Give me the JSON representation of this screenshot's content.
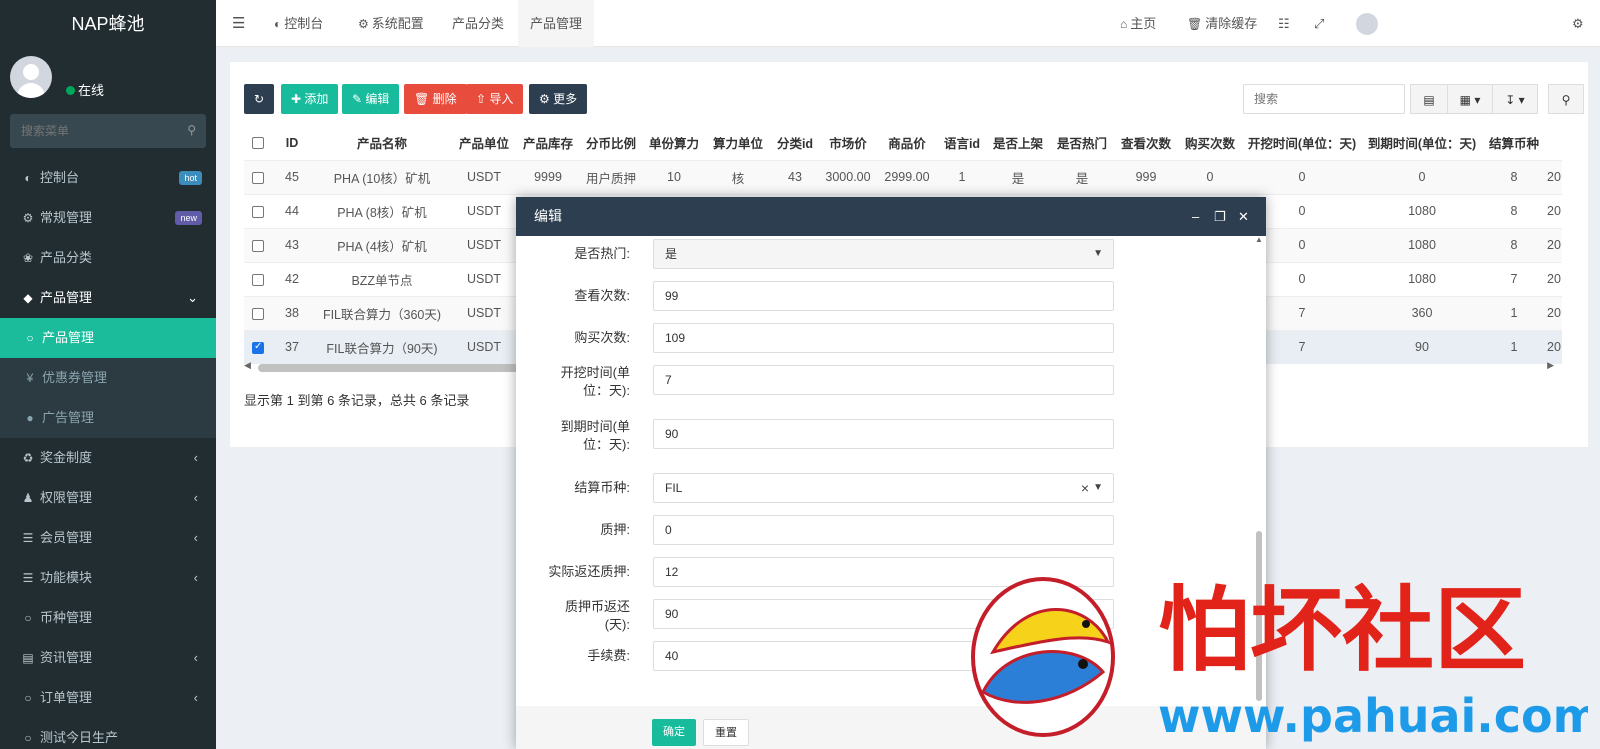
{
  "app": {
    "title": "NAP蜂池",
    "status": "在线",
    "search_placeholder": "搜索菜单"
  },
  "sidebar": {
    "items": [
      {
        "label": "控制台",
        "icon": "dashboard-icon",
        "badge": "hot",
        "badge_color": "#3c8dbc"
      },
      {
        "label": "常规管理",
        "icon": "cogs-icon",
        "badge": "new",
        "badge_color": "#605ca8"
      },
      {
        "label": "产品分类",
        "icon": "leaf-icon"
      },
      {
        "label": "产品管理",
        "icon": "diamond-icon",
        "expanded": true
      },
      {
        "label": "产品管理",
        "icon": "circle-icon",
        "active": true
      },
      {
        "label": "优惠券管理",
        "icon": "yen-icon"
      },
      {
        "label": "广告管理",
        "icon": "dot-icon"
      },
      {
        "label": "奖金制度",
        "icon": "recycle-icon"
      },
      {
        "label": "权限管理",
        "icon": "group-icon"
      },
      {
        "label": "会员管理",
        "icon": "list-icon"
      },
      {
        "label": "功能模块",
        "icon": "list-icon"
      },
      {
        "label": "币种管理",
        "icon": "circle-icon"
      },
      {
        "label": "资讯管理",
        "icon": "table-icon"
      },
      {
        "label": "订单管理",
        "icon": "circle-icon"
      },
      {
        "label": "测试今日生产",
        "icon": "circle-icon"
      }
    ]
  },
  "topbar": {
    "tabs": [
      "控制台",
      "系统配置",
      "产品分类",
      "产品管理"
    ],
    "home": "主页",
    "clear_cache": "清除缓存"
  },
  "toolbar": {
    "add": "添加",
    "edit": "编辑",
    "delete": "删除",
    "import": "导入",
    "more": "更多",
    "search_placeholder": "搜索",
    "colors": {
      "dark": "#2c3e50",
      "green": "#18bc9c",
      "red": "#e74c3c",
      "orange": "#f39c12"
    }
  },
  "table": {
    "columns": [
      "ID",
      "产品名称",
      "产品单位",
      "产品库存",
      "分币比例",
      "单份算力",
      "算力单位",
      "分类id",
      "市场价",
      "商品价",
      "语言id",
      "是否上架",
      "是否热门",
      "查看次数",
      "购买次数",
      "开挖时间(单位：天)",
      "到期时间(单位：天)",
      "结算币种"
    ],
    "rows": [
      {
        "checked": false,
        "cells": [
          "45",
          "PHA (10核）矿机",
          "USDT",
          "9999",
          "用户质押",
          "10",
          "核",
          "43",
          "3000.00",
          "2999.00",
          "1",
          "是",
          "是",
          "999",
          "0",
          "0",
          "0",
          "8"
        ],
        "tail": "20"
      },
      {
        "checked": false,
        "cells": [
          "44",
          "PHA (8核）矿机",
          "USDT",
          "",
          "",
          "",
          "",
          "",
          "",
          "",
          "",
          "",
          "",
          "",
          "",
          "0",
          "1080",
          "8"
        ],
        "tail": "20"
      },
      {
        "checked": false,
        "cells": [
          "43",
          "PHA (4核）矿机",
          "USDT",
          "",
          "",
          "",
          "",
          "",
          "",
          "",
          "",
          "",
          "",
          "",
          "",
          "0",
          "1080",
          "8"
        ],
        "tail": "20"
      },
      {
        "checked": false,
        "cells": [
          "42",
          "BZZ单节点",
          "USDT",
          "",
          "",
          "",
          "",
          "",
          "",
          "",
          "",
          "",
          "",
          "",
          "",
          "0",
          "1080",
          "7"
        ],
        "tail": "20"
      },
      {
        "checked": false,
        "cells": [
          "38",
          "FIL联合算力（360天)",
          "USDT",
          "",
          "",
          "",
          "",
          "",
          "",
          "",
          "",
          "",
          "",
          "",
          "",
          "7",
          "360",
          "1"
        ],
        "tail": "20"
      },
      {
        "checked": true,
        "cells": [
          "37",
          "FIL联合算力（90天)",
          "USDT",
          "",
          "",
          "",
          "",
          "",
          "",
          "",
          "",
          "",
          "",
          "",
          "",
          "7",
          "90",
          "1"
        ],
        "tail": "20"
      }
    ],
    "pager": "显示第 1 到第 6 条记录，总共 6 条记录"
  },
  "modal": {
    "title": "编辑",
    "fields": [
      {
        "label": "是否热门:",
        "value": "是",
        "type": "select"
      },
      {
        "label": "查看次数:",
        "value": "99"
      },
      {
        "label": "购买次数:",
        "value": "109"
      },
      {
        "label": "开挖时间(单位：天):",
        "value": "7"
      },
      {
        "label": "到期时间(单位：天):",
        "value": "90"
      },
      {
        "label": "结算币种:",
        "value": "FIL",
        "type": "select-clear"
      },
      {
        "label": "质押:",
        "value": "0"
      },
      {
        "label": "实际返还质押:",
        "value": "12"
      },
      {
        "label": "质押币返还(天):",
        "value": "90"
      },
      {
        "label": "手续费:",
        "value": "40"
      }
    ],
    "confirm": "确定",
    "reset": "重置"
  },
  "watermark": {
    "text": "怕坏社区",
    "url": "www.pahuai.com"
  }
}
